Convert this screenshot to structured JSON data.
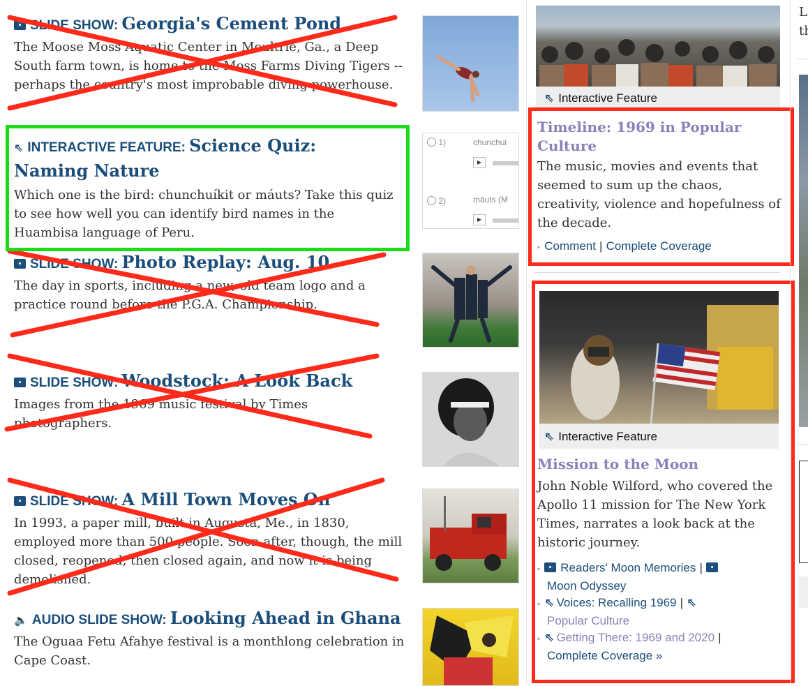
{
  "stories": [
    {
      "kicker": "SLIDE SHOW:",
      "headline": "Georgia's Cement Pond",
      "summary": "The Moose Moss Aquatic Center in Moultrie, Ga., a Deep South farm town, is home to the Moss Farms Diving Tigers -- perhaps the country's most improbable diving powerhouse.",
      "icon": "camera-icon"
    },
    {
      "kicker": "INTERACTIVE FEATURE:",
      "headline": "Science Quiz: Naming Nature",
      "summary": "Which one is the bird: chunchuíkit or máuts? Take this quiz to see how well you can identify bird names in the Huambisa language of Peru.",
      "icon": "interactive-arrow-icon"
    },
    {
      "kicker": "SLIDE SHOW:",
      "headline": "Photo Replay: Aug. 10",
      "summary": "The day in sports, including a new, old team logo and a practice round before the P.G.A. Championship.",
      "icon": "camera-icon"
    },
    {
      "kicker": "SLIDE SHOW:",
      "headline": "Woodstock: A Look Back",
      "summary": "Images from the 1969 music festival by Times photographers.",
      "icon": "camera-icon"
    },
    {
      "kicker": "SLIDE SHOW:",
      "headline": "A Mill Town Moves On",
      "summary": "In 1993, a paper mill, built in Augusta, Me., in 1830, employed more than 500 people. Soon after, though, the mill closed, reopened, then closed again, and now it is being demolished.",
      "icon": "camera-icon"
    },
    {
      "kicker": "AUDIO SLIDE SHOW:",
      "headline": "Looking Ahead in Ghana",
      "summary": "The Oguaa Fetu Afahye festival is a monthlong celebration in Cape Coast.",
      "icon": "speaker-icon"
    }
  ],
  "quiz_thumb": {
    "option1": "1)",
    "label1": "chunchui",
    "option2": "2)",
    "label2": "máuts (M"
  },
  "timeline": {
    "feature_label": "Interactive Feature",
    "title": "Timeline: 1969 in Popular Culture",
    "summary": "The music, movies and events that seemed to sum up the chaos, creativity, violence and hopefulness of the decade.",
    "comment": "Comment",
    "separator": "|",
    "coverage": "Complete Coverage"
  },
  "moon": {
    "feature_label": "Interactive Feature",
    "title": "Mission to the Moon",
    "summary": "John Noble Wilford, who covered the Apollo 11 mission for The New York Times, narrates a look back at the historic journey.",
    "links": [
      {
        "a": "Readers' Moon Memories",
        "b": "Moon Odyssey"
      },
      {
        "a": "Voices: Recalling 1969",
        "b": "Popular Culture"
      },
      {
        "a": "Getting There: 1969 and 2020",
        "b": "Complete Coverage »"
      }
    ],
    "separator": "|"
  },
  "edge": {
    "line1": "L",
    "line2": "th"
  },
  "colors": {
    "link": "#1a4d7a",
    "visited": "#8a82b8",
    "strike": "#ff2a1a",
    "highlight_green": "#1adc1a",
    "highlight_red": "#ff2a1a"
  }
}
